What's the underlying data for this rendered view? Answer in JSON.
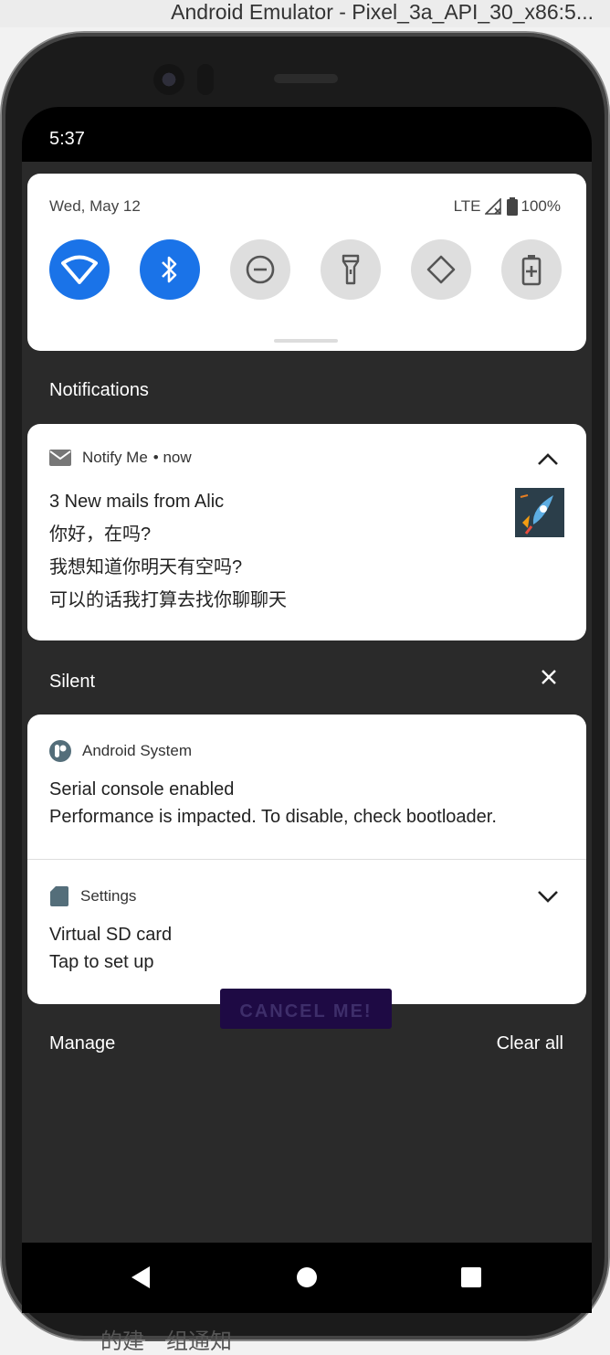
{
  "window": {
    "title": "Android Emulator - Pixel_3a_API_30_x86:5..."
  },
  "status_bar": {
    "time": "5:37"
  },
  "quick_settings": {
    "date": "Wed, May 12",
    "network": "LTE",
    "battery": "100%",
    "tiles": [
      {
        "name": "wifi",
        "active": true
      },
      {
        "name": "bluetooth",
        "active": true
      },
      {
        "name": "do-not-disturb",
        "active": false
      },
      {
        "name": "flashlight",
        "active": false
      },
      {
        "name": "auto-rotate",
        "active": false
      },
      {
        "name": "battery-saver",
        "active": false
      }
    ],
    "colors": {
      "active": "#1a73e8",
      "inactive": "#dedede"
    }
  },
  "notifications_header": "Notifications",
  "notify_me": {
    "app": "Notify Me",
    "time": "• now",
    "lines": [
      "3 New mails from Alic",
      "你好，在吗?",
      "我想知道你明天有空吗?",
      "可以的话我打算去找你聊聊天"
    ]
  },
  "silent_header": "Silent",
  "android_system": {
    "app": "Android System",
    "title": "Serial console enabled",
    "body": "Performance is impacted. To disable, check bootloader."
  },
  "settings_notif": {
    "app": "Settings",
    "title": "Virtual SD card",
    "body": "Tap to set up"
  },
  "background_app": {
    "button": "CANCEL ME!",
    "partial_text": "的建一组通知"
  },
  "footer": {
    "manage": "Manage",
    "clear_all": "Clear all"
  }
}
